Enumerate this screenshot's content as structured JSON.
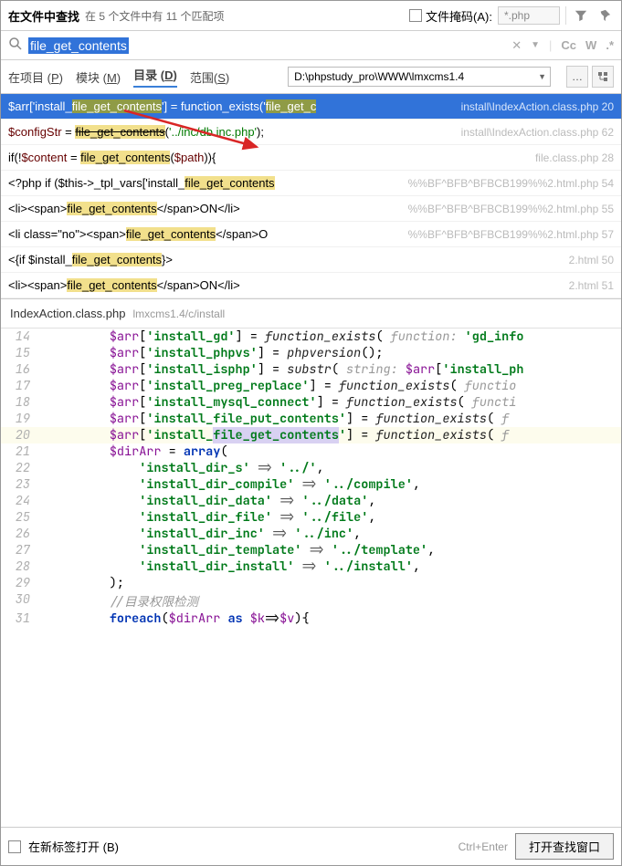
{
  "header": {
    "title": "在文件中查找",
    "subtitle": "在 5 个文件中有 11 个匹配项",
    "filemask_label": "文件掩码(A):",
    "filemask_value": "*.php"
  },
  "search": {
    "query": "file_get_contents",
    "cc": "Cc",
    "w": "W",
    "star": ".*"
  },
  "scope": {
    "tabs": [
      {
        "label": "在项目",
        "hotkey": "P"
      },
      {
        "label": "模块",
        "hotkey": "M"
      },
      {
        "label": "目录",
        "hotkey": "D"
      },
      {
        "label": "范围",
        "hotkey": "S"
      }
    ],
    "path": "D:\\phpstudy_pro\\WWW\\lmxcms1.4"
  },
  "results": [
    {
      "selected": true,
      "pre": "$arr['install_",
      "hl": "file_get_contents",
      "mid": "'] = function_exists('",
      "hl2": "file_get_c",
      "file": "install\\IndexAction.class.php",
      "line": "20"
    },
    {
      "pre": "$configStr = ",
      "hl": "file_get_contents",
      "post": "('../inc/db.inc.php');",
      "file": "install\\IndexAction.class.php",
      "line": "62"
    },
    {
      "pre": "if(!$content = ",
      "hl": "file_get_contents",
      "post": "($path)){",
      "file": "file.class.php",
      "line": "28"
    },
    {
      "pre": "<?php if ($this->_tpl_vars['install_",
      "hl": "file_get_contents",
      "file": "%%BF^BFB^BFBCB199%%2.html.php",
      "line": "54"
    },
    {
      "pre": "<li><span>",
      "hl": "file_get_contents",
      "post": "</span>ON</li>",
      "file": "%%BF^BFB^BFBCB199%%2.html.php",
      "line": "55"
    },
    {
      "pre": "<li class=\"no\"><span>",
      "hl": "file_get_contents",
      "post": "</span>O",
      "file": "%%BF^BFB^BFBCB199%%2.html.php",
      "line": "57"
    },
    {
      "pre": "<{if $install_",
      "hl": "file_get_contents",
      "post": "}>",
      "file": "2.html",
      "line": "50"
    },
    {
      "pre": "<li><span>",
      "hl": "file_get_contents",
      "post": "</span>ON</li>",
      "file": "2.html",
      "line": "51"
    }
  ],
  "editor": {
    "filename": "IndexAction.class.php",
    "filepath": "lmxcms1.4/c/install",
    "lines": [
      {
        "n": "14",
        "html": "        <span class='k-var'>$arr</span>[<span class='k-str'>'install_gd'</span>] = <span class='k-fn'>function_exists</span>( <span class='k-hint'>function:</span> <span class='k-str'>'gd_info</span>"
      },
      {
        "n": "15",
        "html": "        <span class='k-var'>$arr</span>[<span class='k-str'>'install_phpvs'</span>] = <span class='k-fn'>phpversion</span>();"
      },
      {
        "n": "16",
        "html": "        <span class='k-var'>$arr</span>[<span class='k-str'>'install_isphp'</span>] = <span class='k-fn'>substr</span>( <span class='k-hint'>string:</span> <span class='k-var'>$arr</span>[<span class='k-str'>'install_ph</span>"
      },
      {
        "n": "17",
        "html": "        <span class='k-var'>$arr</span>[<span class='k-str'>'install_preg_replace'</span>] = <span class='k-fn'>function_exists</span>( <span class='k-hint'>functio</span>"
      },
      {
        "n": "18",
        "html": "        <span class='k-var'>$arr</span>[<span class='k-str'>'install_mysql_connect'</span>] = <span class='k-fn'>function_exists</span>( <span class='k-hint'>functi</span>"
      },
      {
        "n": "19",
        "html": "        <span class='k-var'>$arr</span>[<span class='k-str'>'install_file_put_contents'</span>] = <span class='k-fn'>function_exists</span>( <span class='k-hint'>f</span>"
      },
      {
        "n": "20",
        "hl": true,
        "html": "        <span class='k-var'>$arr</span>[<span class='k-str'>'install_<span class='sel-token'>file_get_contents</span>'</span>] = <span class='k-fn'>function_exists</span>( <span class='k-hint'>f</span>"
      },
      {
        "n": "21",
        "html": "        <span class='k-var'>$dirArr</span> = <span class='k-kw'>array</span>("
      },
      {
        "n": "22",
        "html": "            <span class='k-str'>'install_dir_s'</span> <span class='k-arrow'>=&gt;</span> <span class='k-str'>'../'</span>,"
      },
      {
        "n": "23",
        "html": "            <span class='k-str'>'install_dir_compile'</span> <span class='k-arrow'>=&gt;</span> <span class='k-str'>'../compile'</span>,"
      },
      {
        "n": "24",
        "html": "            <span class='k-str'>'install_dir_data'</span> <span class='k-arrow'>=&gt;</span> <span class='k-str'>'../data'</span>,"
      },
      {
        "n": "25",
        "html": "            <span class='k-str'>'install_dir_file'</span> <span class='k-arrow'>=&gt;</span> <span class='k-str'>'../file'</span>,"
      },
      {
        "n": "26",
        "html": "            <span class='k-str'>'install_dir_inc'</span> <span class='k-arrow'>=&gt;</span> <span class='k-str'>'../inc'</span>,"
      },
      {
        "n": "27",
        "html": "            <span class='k-str'>'install_dir_template'</span> <span class='k-arrow'>=&gt;</span> <span class='k-str'>'../template'</span>,"
      },
      {
        "n": "28",
        "html": "            <span class='k-str'>'install_dir_install'</span> <span class='k-arrow'>=&gt;</span> <span class='k-str'>'../install'</span>,"
      },
      {
        "n": "29",
        "html": "        );"
      },
      {
        "n": "30",
        "html": "        <span class='k-comment'>//目录权限检测</span>"
      },
      {
        "n": "31",
        "html": "        <span class='k-kw'>foreach</span>(<span class='k-var'>$dirArr</span> <span class='k-kw'>as</span> <span class='k-var'>$k</span>=&gt;<span class='k-var'>$v</span>){"
      }
    ]
  },
  "footer": {
    "newtab_label": "在新标签打开 (B)",
    "hint": "Ctrl+Enter",
    "open_btn": "打开查找窗口"
  }
}
